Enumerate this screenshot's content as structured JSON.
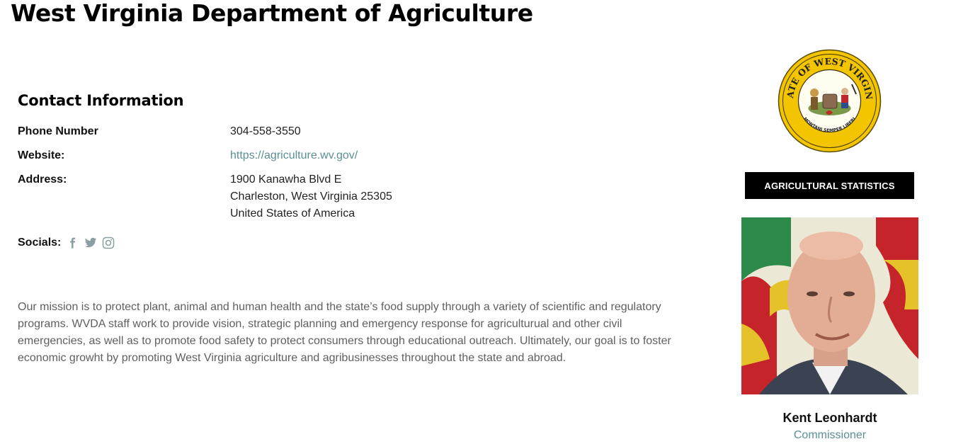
{
  "header": {
    "title": "West Virginia Department of Agriculture"
  },
  "contact": {
    "heading": "Contact Information",
    "phone_label": "Phone Number",
    "phone_value": "304-558-3550",
    "website_label": "Website:",
    "website_value": "https://agriculture.wv.gov/",
    "address_label": "Address:",
    "address_lines": [
      "1900 Kanawha Blvd E",
      "Charleston, West Virginia 25305",
      "United States of America"
    ],
    "socials_label": "Socials:"
  },
  "socials": [
    {
      "icon": "facebook-icon"
    },
    {
      "icon": "twitter-icon"
    },
    {
      "icon": "instagram-icon"
    }
  ],
  "mission": "Our mission is to protect plant, animal and human health and the state’s food supply through a variety of scientific and regulatory programs. WVDA staff work to provide vision, strategic planning and emergency response for agriculturual and other civil emergencies, as well as to promote food safety to protect consumers through educational outreach. Ultimately, our goal is to foster economic growht by promoting West Virginia agriculture and agribusinesses throughout the state and abroad.",
  "sidebar": {
    "seal_text_top": "STATE OF WEST VIRGINIA",
    "seal_text_bottom": "MONTANI SEMPER LIBERI",
    "stats_button": "AGRICULTURAL STATISTICS",
    "person_name": "Kent Leonhardt",
    "person_title": "Commissioner"
  },
  "colors": {
    "link": "#5b8f93",
    "seal_gold": "#f2c500",
    "button_bg": "#000000"
  }
}
